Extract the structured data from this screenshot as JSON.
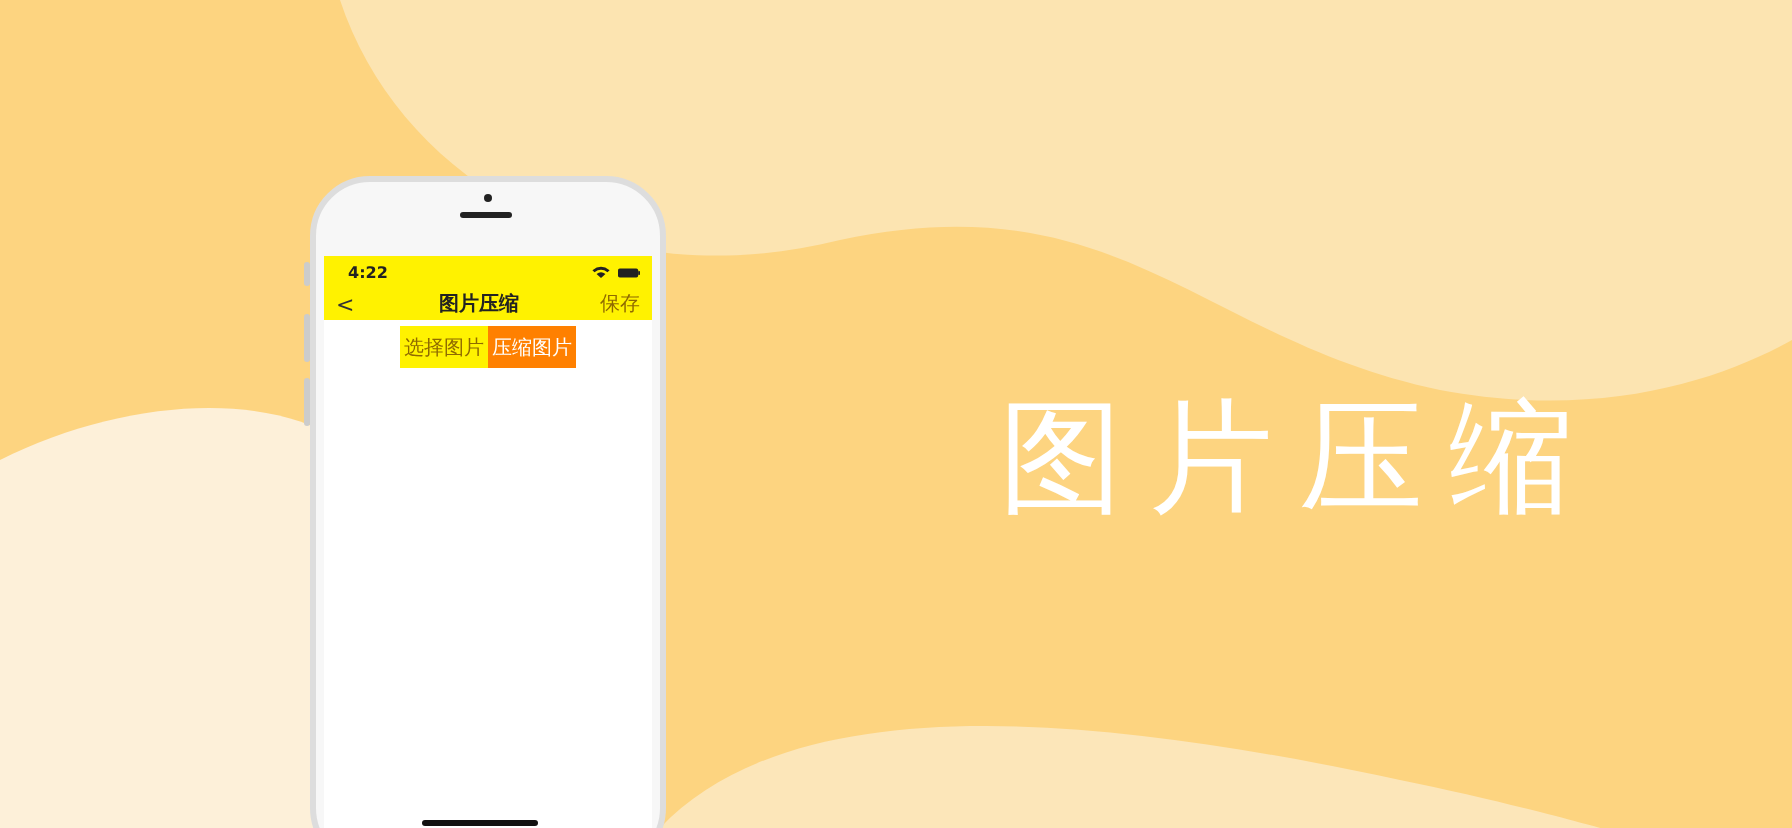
{
  "phone": {
    "status_bar": {
      "time": "4:22"
    },
    "nav_bar": {
      "back": "<",
      "title": "图片压缩",
      "action": "保存"
    },
    "buttons": [
      {
        "label": "选择图片",
        "color": "#fff200"
      },
      {
        "label": "压缩图片",
        "color": "#ff8000"
      }
    ]
  },
  "headline": "图片压缩"
}
